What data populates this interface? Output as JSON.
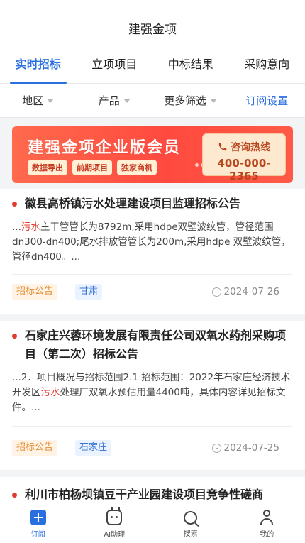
{
  "header": {
    "title": "建强金项"
  },
  "tabs": [
    {
      "label": "实时招标",
      "active": true
    },
    {
      "label": "立项项目",
      "active": false
    },
    {
      "label": "中标结果",
      "active": false
    },
    {
      "label": "采购意向",
      "active": false
    }
  ],
  "filters": {
    "region": "地区",
    "product": "产品",
    "more": "更多筛选",
    "subscribe_settings": "订阅设置"
  },
  "banner": {
    "title": "建强金项企业版会员",
    "chips": [
      "数据导出",
      "前期项目",
      "独家商机"
    ],
    "hotline_label": "咨询热线",
    "hotline_number": "400-000-2365",
    "icon": "phone-icon"
  },
  "cards": [
    {
      "title": "徽县高桥镇污水处理建设项目监理招标公告",
      "desc_pre": "...",
      "desc_hl": "污水",
      "desc_post": "主干管管长为8792m,采用hdpe双壁波纹管，管径范围dn300-dn400;尾水排放管管长为200m,采用hdpe 双壁波纹管，管径dn400。...",
      "tag_type": "招标公告",
      "tag_region": "甘肃",
      "date": "2024-07-26"
    },
    {
      "title": "石家庄兴蓉环境发展有限责任公司双氧水药剂采购项目（第二次）招标公告",
      "desc_pre": "...2．项目概况与招标范围2.1 招标范围：2022年石家庄经济技术开发区",
      "desc_hl": "污水",
      "desc_post": "处理厂双氧水预估用量4400吨，具体内容详见招标文件。...",
      "tag_type": "招标公告",
      "tag_region": "石家庄",
      "date": "2024-07-25"
    },
    {
      "title": "利川市柏杨坝镇豆干产业园建设项目竞争性磋商"
    }
  ],
  "bottom_nav": [
    {
      "label": "订阅",
      "icon": "subscribe-icon",
      "active": true
    },
    {
      "label": "AI助理",
      "icon": "ai-robot-icon",
      "active": false
    },
    {
      "label": "搜索",
      "icon": "search-icon",
      "active": false
    },
    {
      "label": "我的",
      "icon": "profile-icon",
      "active": false
    }
  ],
  "colors": {
    "accent": "#2a6fe0",
    "highlight": "#e23a2f",
    "banner": "#ff4a3f"
  }
}
